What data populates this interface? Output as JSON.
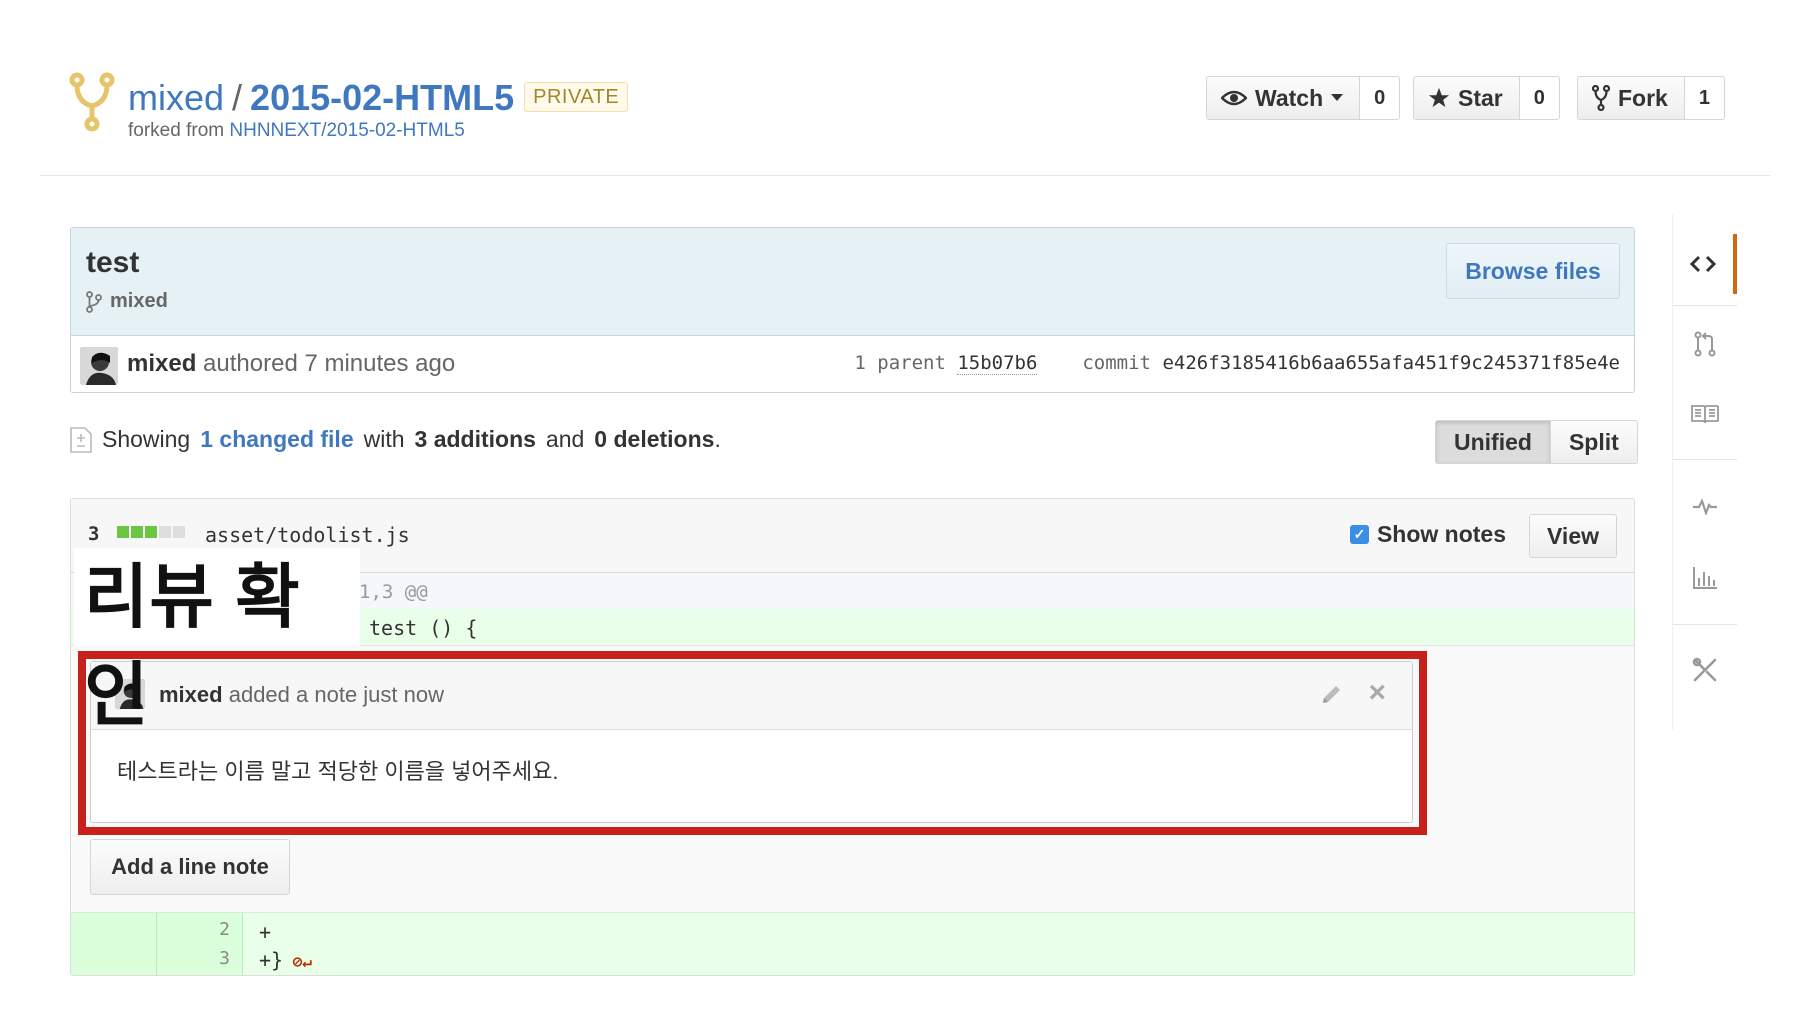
{
  "repo": {
    "owner": "mixed",
    "separator": "/",
    "name": "2015-02-HTML5",
    "badge": "PRIVATE",
    "forked_prefix": "forked from",
    "forked_source": "NHNNEXT/2015-02-HTML5"
  },
  "actions": {
    "watch": {
      "label": "Watch",
      "count": "0"
    },
    "star": {
      "label": "Star",
      "count": "0"
    },
    "fork": {
      "label": "Fork",
      "count": "1"
    }
  },
  "commit": {
    "title": "test",
    "branch": "mixed",
    "browse_label": "Browse files",
    "author": "mixed",
    "authored_text": "authored 7 minutes ago",
    "parent_label": "1 parent",
    "parent_sha": "15b07b6",
    "commit_label": "commit",
    "commit_sha": "e426f3185416b6aa655afa451f9c245371f85e4e"
  },
  "toc": {
    "showing": "Showing",
    "changed": "1 changed file",
    "with": "with",
    "additions": "3 additions",
    "and": "and",
    "deletions": "0 deletions",
    "period": "."
  },
  "view_toggle": {
    "unified": "Unified",
    "split": "Split"
  },
  "file": {
    "count": "3",
    "path": "asset/todolist.js",
    "show_notes": "Show notes",
    "view_label": "View",
    "hunk": "1,3 @@",
    "line1_code": "test () {",
    "line2_num": "2",
    "line2_code": "+",
    "line3_num": "3",
    "line3_code": "+}"
  },
  "overlay_label": "리뷰 확인",
  "note": {
    "author": "mixed",
    "action": "added a note just now",
    "body": "테스트라는 이름 말고 적당한 이름을 넣어주세요."
  },
  "add_note_label": "Add a line note",
  "colors": {
    "accent": "#4078c0",
    "highlight_frame": "#c6221b",
    "sidebar_active": "#d26911",
    "addition_bg": "#eaffea"
  }
}
